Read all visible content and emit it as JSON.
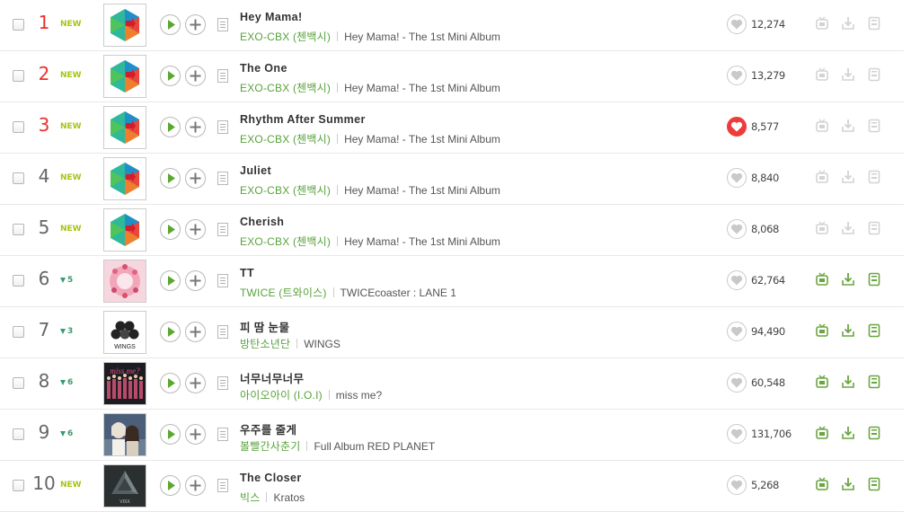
{
  "accent_green": "#58a33b",
  "rank_top_color": "#e8312f",
  "songs": [
    {
      "rank": "1",
      "change": "NEW",
      "change_type": "new",
      "title": "Hey Mama!",
      "artist": "EXO-CBX (첸백시)",
      "album": "Hey Mama! - The 1st Mini Album",
      "likes": "12,274",
      "liked": false,
      "cover": "exo-cbx",
      "actions_enabled": false
    },
    {
      "rank": "2",
      "change": "NEW",
      "change_type": "new",
      "title": "The One",
      "artist": "EXO-CBX (첸백시)",
      "album": "Hey Mama! - The 1st Mini Album",
      "likes": "13,279",
      "liked": false,
      "cover": "exo-cbx",
      "actions_enabled": false
    },
    {
      "rank": "3",
      "change": "NEW",
      "change_type": "new",
      "title": "Rhythm After Summer",
      "artist": "EXO-CBX (첸백시)",
      "album": "Hey Mama! - The 1st Mini Album",
      "likes": "8,577",
      "liked": true,
      "cover": "exo-cbx",
      "actions_enabled": false
    },
    {
      "rank": "4",
      "change": "NEW",
      "change_type": "new",
      "title": "Juliet",
      "artist": "EXO-CBX (첸백시)",
      "album": "Hey Mama! - The 1st Mini Album",
      "likes": "8,840",
      "liked": false,
      "cover": "exo-cbx",
      "actions_enabled": false
    },
    {
      "rank": "5",
      "change": "NEW",
      "change_type": "new",
      "title": "Cherish",
      "artist": "EXO-CBX (첸백시)",
      "album": "Hey Mama! - The 1st Mini Album",
      "likes": "8,068",
      "liked": false,
      "cover": "exo-cbx",
      "actions_enabled": false
    },
    {
      "rank": "6",
      "change": "5",
      "change_type": "down",
      "title": "TT",
      "artist": "TWICE (트와이스)",
      "album": "TWICEcoaster : LANE 1",
      "likes": "62,764",
      "liked": false,
      "cover": "twice",
      "actions_enabled": true
    },
    {
      "rank": "7",
      "change": "3",
      "change_type": "down",
      "title": "피 땀 눈물",
      "artist": "방탄소년단",
      "album": "WINGS",
      "likes": "94,490",
      "liked": false,
      "cover": "wings",
      "actions_enabled": true
    },
    {
      "rank": "8",
      "change": "6",
      "change_type": "down",
      "title": "너무너무너무",
      "artist": "아이오아이 (I.O.I)",
      "album": "miss me?",
      "likes": "60,548",
      "liked": false,
      "cover": "missme",
      "actions_enabled": true
    },
    {
      "rank": "9",
      "change": "6",
      "change_type": "down",
      "title": "우주를 줄게",
      "artist": "볼빨간사춘기",
      "album": "Full Album RED PLANET",
      "likes": "131,706",
      "liked": false,
      "cover": "redplanet",
      "actions_enabled": true
    },
    {
      "rank": "10",
      "change": "NEW",
      "change_type": "new",
      "title": "The Closer",
      "artist": "빅스",
      "album": "Kratos",
      "likes": "5,268",
      "liked": false,
      "cover": "vixx",
      "actions_enabled": true
    }
  ],
  "cover_text": {
    "wings": "WINGS",
    "missme": "miss me?",
    "vixx": "VIXX"
  }
}
